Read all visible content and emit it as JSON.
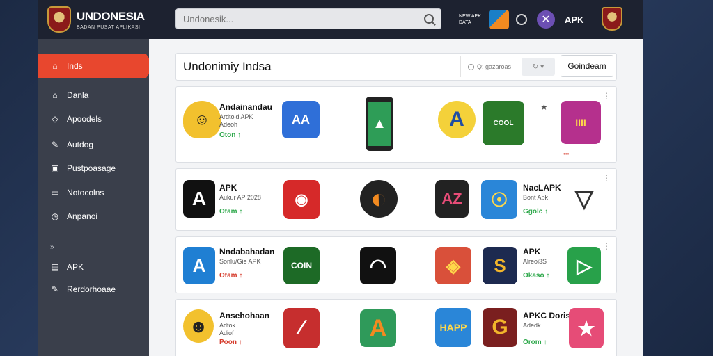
{
  "brand": {
    "title": "UNDONESIA",
    "subtitle": "BADAN PUSAT APLIKASI"
  },
  "search": {
    "placeholder": "Undonesik..."
  },
  "topbar": {
    "mini_text": "NEW APK DATA",
    "apk_label": "APK",
    "x_label": "✕"
  },
  "sidebar": {
    "items": [
      {
        "label": "Inds",
        "icon": "home-icon",
        "glyph": "⌂"
      },
      {
        "label": "Danla",
        "icon": "house-icon",
        "glyph": "⌂"
      },
      {
        "label": "Apoodels",
        "icon": "shield-icon",
        "glyph": "◇"
      },
      {
        "label": "Autdog",
        "icon": "pen-icon",
        "glyph": "✎"
      },
      {
        "label": "Pustpoasage",
        "icon": "image-icon",
        "glyph": "▣"
      },
      {
        "label": "Notocolns",
        "icon": "folder-icon",
        "glyph": "▭"
      },
      {
        "label": "Anpanoi",
        "icon": "clock-icon",
        "glyph": "◷"
      },
      {
        "label": "APK",
        "icon": "database-icon",
        "glyph": "▤"
      },
      {
        "label": "Rerdorhoaae",
        "icon": "edit-icon",
        "glyph": "✎"
      }
    ],
    "heading": "»"
  },
  "main": {
    "title": "Undonimiy Indsa",
    "filter_label": "Q: gazaroas",
    "sort_label": "↻ ▾",
    "header_button": "Goindeam"
  },
  "rows": [
    {
      "name": "Andainandau",
      "sub1": "Ardtoid APK",
      "sub2": "Adeoh",
      "stat": "Oton ↑",
      "apps": [
        {
          "label": "AA",
          "bg": "#2f6fd8",
          "fg": "#ffffff"
        },
        {
          "label": "▲",
          "bg": "#2e9d57",
          "fg": "#ffffff"
        },
        {
          "label": "A",
          "bg": "#f4d13a",
          "fg": "#1f4da3"
        },
        {
          "label": "COOL",
          "bg": "#2b7a2a",
          "fg": "#ffffff"
        },
        {
          "label": "IIII",
          "bg": "#b5308d",
          "fg": "#ffd84a"
        }
      ],
      "badge": "•••"
    },
    {
      "name": "APK",
      "sub1": "Aukur AP 2028",
      "sub2": "",
      "stat": "Otam ↑",
      "apps": [
        {
          "label": "◉",
          "bg": "#d62929",
          "fg": "#ffffff"
        },
        {
          "label": "◐",
          "bg": "#222222",
          "fg": "#f28a20"
        },
        {
          "label": "AZ",
          "bg": "#222222",
          "fg": "#e64c77"
        },
        {
          "label": "☉",
          "bg": "#2a86d8",
          "fg": "#ffd84a"
        },
        {
          "label": "▽",
          "bg": "#ffffff",
          "fg": "#333333"
        }
      ],
      "right_name": "NacLAPK",
      "right_sub": "Bont Apk",
      "right_stat": "Ggolc ↑"
    },
    {
      "name": "Nndabahadan",
      "sub1": "Sonlu/Gie APK",
      "sub2": "",
      "stat": "Otam ↑",
      "apps": [
        {
          "label": "A",
          "bg": "#1f7fd3",
          "fg": "#ffffff"
        },
        {
          "label": "COIN",
          "bg": "#1d6a26",
          "fg": "#ffffff"
        },
        {
          "label": "◠",
          "bg": "#111111",
          "fg": "#ffffff"
        },
        {
          "label": "◈",
          "bg": "#d9503a",
          "fg": "#ffd84a"
        },
        {
          "label": "S",
          "bg": "#1d2a50",
          "fg": "#f2b52b"
        },
        {
          "label": "▷",
          "bg": "#28a14a",
          "fg": "#ffffff"
        }
      ],
      "right_name": "APK",
      "right_sub": "Alreoi3S",
      "right_stat": "Okaso ↑"
    },
    {
      "name": "Ansehohaan",
      "sub1": "Adtok",
      "sub2": "Adiof",
      "stat": "Poon ↑",
      "apps": [
        {
          "label": "∕",
          "bg": "#c62e2e",
          "fg": "#ffffff"
        },
        {
          "label": "A",
          "bg": "#2f9a5a",
          "fg": "#f28a20"
        },
        {
          "label": "HAPP",
          "bg": "#2a86d8",
          "fg": "#ffd84a"
        },
        {
          "label": "G",
          "bg": "#7a1f1f",
          "fg": "#f2b52b"
        },
        {
          "label": "★",
          "bg": "#e64c77",
          "fg": "#ffffff"
        }
      ],
      "right_name": "APKC Dorisa",
      "right_sub": "Adedk",
      "right_stat": "Orom ↑"
    }
  ],
  "colors": {
    "accent": "#e8472e",
    "sidebar": "#3a3f4b",
    "topbar": "#1d2230"
  }
}
